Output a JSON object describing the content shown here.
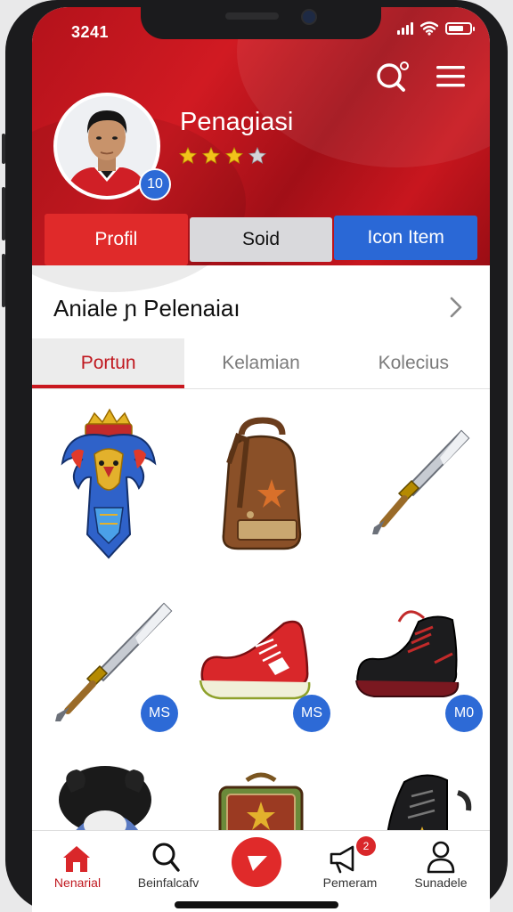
{
  "status_bar": {
    "time": "3241"
  },
  "header": {
    "player_name": "Penagiasi",
    "level_badge": "10",
    "stars_filled": 3,
    "stars_total": 4,
    "search_icon": "search-icon",
    "menu_icon": "hamburger-menu-icon"
  },
  "top_tabs": [
    {
      "label": "Profil"
    },
    {
      "label": "Soid"
    },
    {
      "label": "Icon Item"
    }
  ],
  "section": {
    "title": "Aniale ɲ Pelenaiaı"
  },
  "sub_tabs": [
    {
      "label": "Portun",
      "active": true
    },
    {
      "label": "Kelamian",
      "active": false
    },
    {
      "label": "Kolecius",
      "active": false
    }
  ],
  "items": [
    {
      "name": "garuda-emblem",
      "badge": ""
    },
    {
      "name": "leather-backpack",
      "badge": ""
    },
    {
      "name": "sword",
      "badge": ""
    },
    {
      "name": "sword",
      "badge": "MS"
    },
    {
      "name": "red-sneaker",
      "badge": "MS"
    },
    {
      "name": "black-boot",
      "badge": "M0"
    },
    {
      "name": "furry-mascot",
      "badge": ""
    },
    {
      "name": "ornate-chest",
      "badge": ""
    },
    {
      "name": "black-boot",
      "badge": ""
    }
  ],
  "bottom_nav": [
    {
      "label": "Nenarial",
      "icon": "home-icon",
      "active": true
    },
    {
      "label": "Beinfalcafv",
      "icon": "search-icon",
      "active": false
    },
    {
      "label": "Pemeram",
      "icon": "megaphone-icon",
      "active": false,
      "notification": "2"
    },
    {
      "label": "Sunadele",
      "icon": "user-icon",
      "active": false
    }
  ],
  "colors": {
    "brand_red": "#c9181f",
    "accent_blue": "#2a68d6"
  }
}
